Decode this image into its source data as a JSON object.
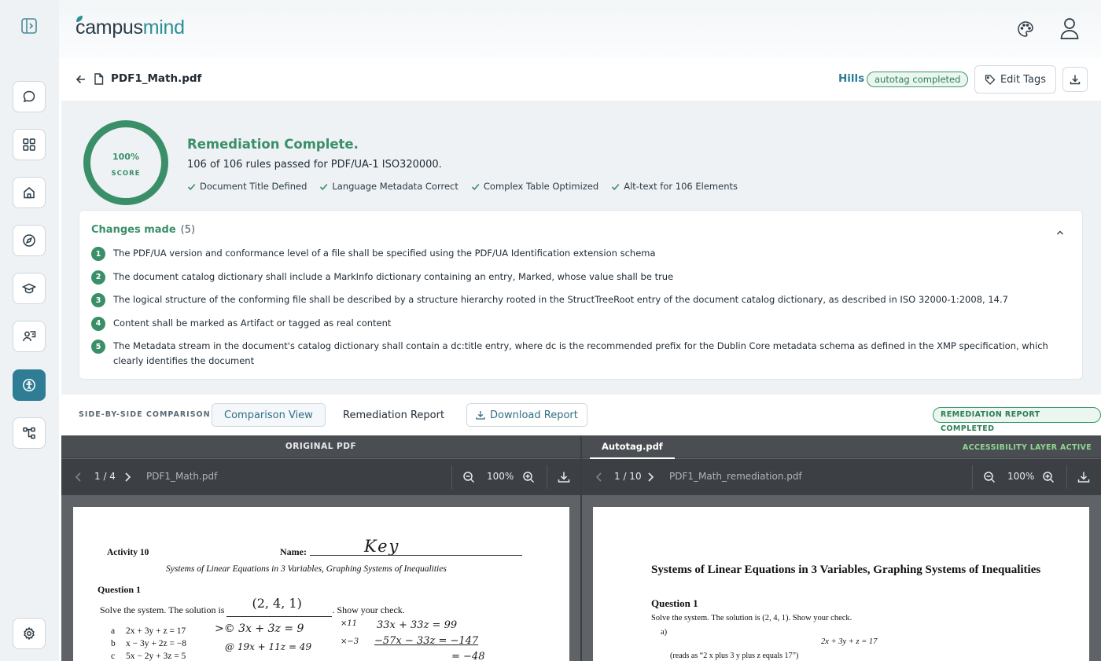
{
  "app": {
    "logo_a": "campus",
    "logo_b": "mind"
  },
  "document": {
    "filename": "PDF1_Math.pdf",
    "workspace": "Hills",
    "status_badge": "autotag completed",
    "edit_tags_label": "Edit Tags"
  },
  "summary": {
    "score_value": "100%",
    "score_label": "SCORE",
    "title": "Remediation Complete.",
    "subtitle": "106 of 106 rules passed for PDF/UA-1 ISO320000.",
    "checks": [
      "Document Title Defined",
      "Language Metadata Correct",
      "Complex Table Optimized",
      "Alt-text for 106 Elements"
    ]
  },
  "changes": {
    "title": "Changes made",
    "count": "(5)",
    "items": [
      {
        "n": "1",
        "text": "The PDF/UA version and conformance level of a file shall be specified using the PDF/UA Identification extension schema"
      },
      {
        "n": "2",
        "text": "The document catalog dictionary shall include a MarkInfo dictionary containing an entry, Marked, whose value shall be true"
      },
      {
        "n": "3",
        "text": "The logical structure of the conforming file shall be described by a structure hierarchy rooted in the StructTreeRoot entry of the document catalog dictionary, as described in ISO 32000-1:2008, 14.7"
      },
      {
        "n": "4",
        "text": "Content shall be marked as Artifact or tagged as real content"
      },
      {
        "n": "5",
        "text": "The Metadata stream in the document's catalog dictionary shall contain a dc:title entry, where dc is the recommended prefix for the Dublin Core metadata schema as defined in the XMP specification, which clearly identifies the document"
      }
    ]
  },
  "comparison": {
    "label": "SIDE-BY-SIDE COMPARISON",
    "tab_comparison": "Comparison View",
    "tab_report": "Remediation Report",
    "download_report": "Download Report",
    "report_badge": "REMEDIATION REPORT COMPLETED"
  },
  "left_pane": {
    "title": "ORIGINAL PDF",
    "page_indicator": "1 / 4",
    "filename": "PDF1_Math.pdf",
    "zoom": "100%"
  },
  "right_pane": {
    "tab": "Autotag.pdf",
    "layer_status": "ACCESSIBILITY LAYER ACTIVE",
    "page_indicator": "1 / 10",
    "filename": "PDF1_Math_remediation.pdf",
    "zoom": "100%"
  },
  "left_doc": {
    "activity": "Activity 10",
    "name_label": "Name:",
    "name_value": "Key",
    "subtitle": "Systems of Linear Equations in 3 Variables, Graphing Systems of Inequalities",
    "question": "Question 1",
    "solve_a": "Solve the system.  The solution is",
    "solution": "(2, 4, 1)",
    "solve_b": ". Show your check.",
    "eq_a_label": "a",
    "eq_a": "2x + 3y + z = 17",
    "eq_b_label": "b",
    "eq_b": "x − 3y + 2z = −8",
    "eq_c_label": "c",
    "eq_c": "5x − 2y + 3z = 5",
    "work_1": ">© 3x + 3z = 9",
    "work_2": "@ 19x + 11z = 49",
    "mult_1": "×11",
    "mult_2": "×−3",
    "work_3": "33x + 33z = 99",
    "work_4": "−57x − 33z = −147",
    "work_5": "= −48"
  },
  "right_doc": {
    "heading": "Systems of Linear Equations in 3 Variables, Graphing Systems of Inequalities",
    "question": "Question 1",
    "body": "Solve the system. The solution is (2, 4, 1). Show your check.",
    "item_a": "a)",
    "equation": "2x + 3y + z = 17",
    "reads_as": "(reads as “2 x plus 3 y plus z equals 17”)"
  }
}
